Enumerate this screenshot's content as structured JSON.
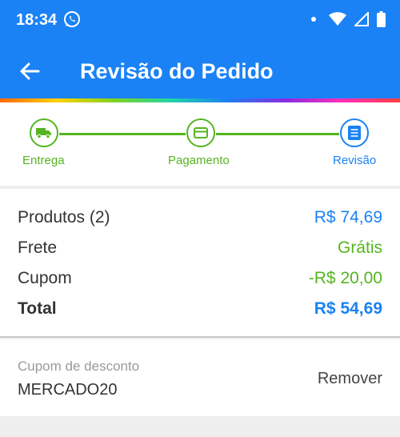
{
  "status_bar": {
    "time": "18:34"
  },
  "toolbar": {
    "title": "Revisão do Pedido"
  },
  "stepper": {
    "steps": [
      {
        "label": "Entrega"
      },
      {
        "label": "Pagamento"
      },
      {
        "label": "Revisão"
      }
    ],
    "colors": {
      "done": "#55b520",
      "current": "#1a82f5"
    }
  },
  "summary": {
    "products_label": "Produtos (2)",
    "products_value": "R$ 74,69",
    "shipping_label": "Frete",
    "shipping_value": "Grátis",
    "coupon_label": "Cupom",
    "coupon_value": "-R$ 20,00",
    "total_label": "Total",
    "total_value": "R$ 54,69"
  },
  "coupon": {
    "label": "Cupom de desconto",
    "code": "MERCADO20",
    "remove_label": "Remover"
  },
  "colors": {
    "brand_blue": "#1a82f5",
    "success_green": "#55b520"
  }
}
